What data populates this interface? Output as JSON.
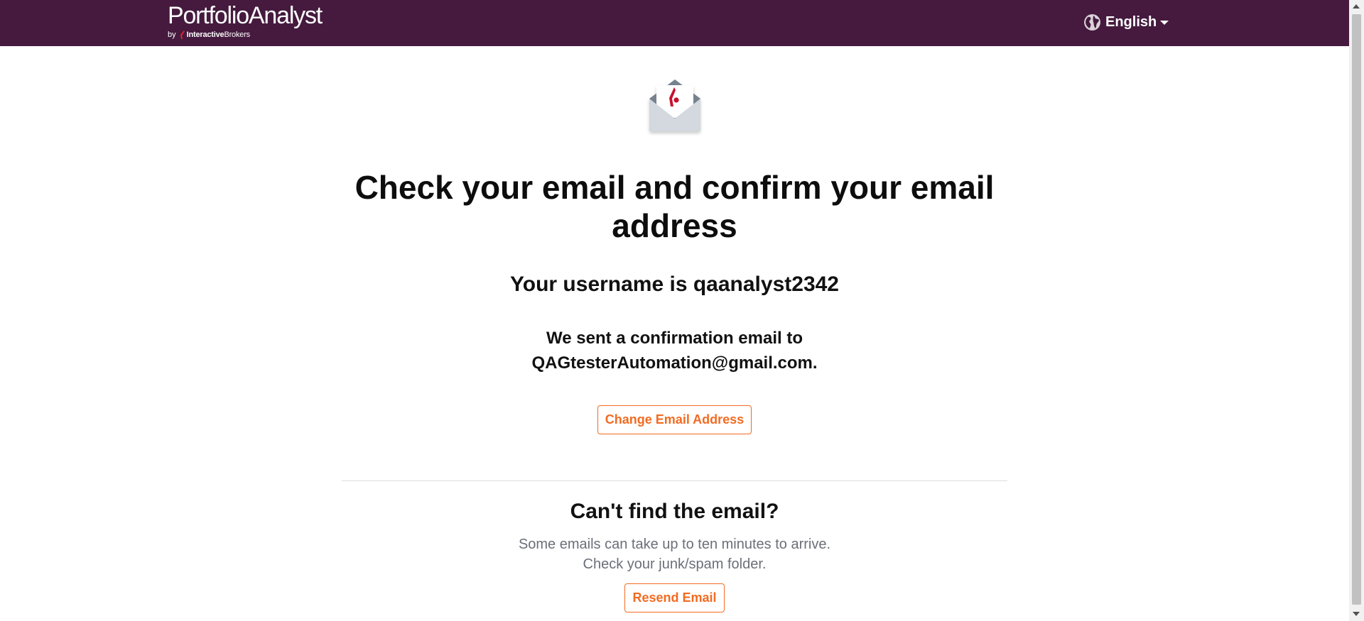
{
  "header": {
    "brand_name": "PortfolioAnalyst",
    "brand_by": "by",
    "brand_ib_bold": "Interactive",
    "brand_ib_regular": "Brokers",
    "language_label": "English",
    "background_color": "#451a3e"
  },
  "main": {
    "title": "Check your email and confirm your email address",
    "username_text": "Your username is qaanalyst2342",
    "sent_line1": "We sent a confirmation email to",
    "sent_line2": "QAGtesterAutomation@gmail.com.",
    "change_email_label": "Change Email Address"
  },
  "help": {
    "heading": "Can't find the email?",
    "line1": "Some emails can take up to ten minutes to arrive.",
    "line2": "Check your junk/spam folder.",
    "resend_label": "Resend Email"
  },
  "theme": {
    "accent": "#f26b22",
    "muted_text": "#6b6f78"
  },
  "icons": {
    "envelope": "envelope-open-icon",
    "globe": "globe-icon",
    "caret": "caret-down-icon"
  }
}
